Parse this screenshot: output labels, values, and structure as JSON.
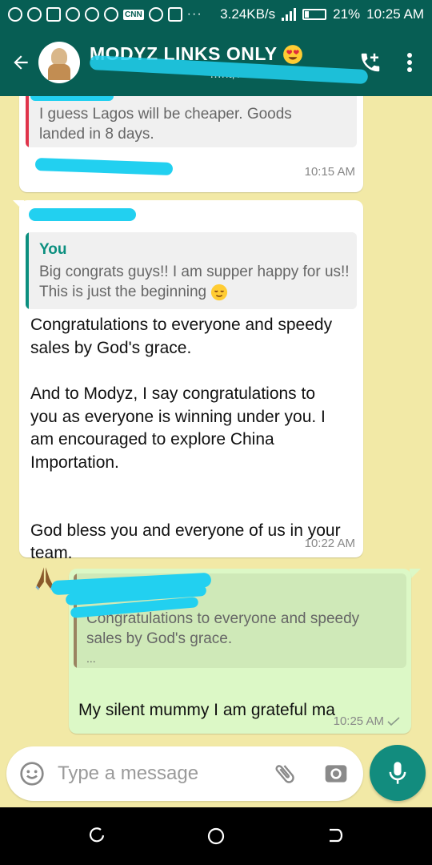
{
  "status_bar": {
    "speed": "3.24KB/s",
    "battery": "21%",
    "time": "10:25 AM",
    "app_badge": "CNN"
  },
  "header": {
    "group_name": "MODYZ LINKS ONLY",
    "subtitle": "…nt, Au…"
  },
  "messages": [
    {
      "direction": "incoming",
      "quote_text": "I guess Lagos will be cheaper. Goods landed in 8 days.",
      "time": "10:15 AM"
    },
    {
      "direction": "incoming",
      "quote_author": "You",
      "quote_text": "Big congrats guys!! I am supper happy for us!! This is just the beginning",
      "body_para1": "Congratulations to everyone and speedy sales by God's grace.",
      "body_para2": "And to Modyz, I say congratulations to you as everyone is winning under you. I am encouraged to explore China Importation.",
      "body_para3": "God bless you and everyone of us in your team.",
      "time": "10:22 AM"
    },
    {
      "direction": "outgoing",
      "quote_text": "Congratulations to everyone and speedy sales by God's grace.",
      "quote_more": "...",
      "body": "My silent mummy I am grateful ma",
      "time": "10:25 AM"
    }
  ],
  "composer": {
    "placeholder": "Type a message"
  },
  "colors": {
    "header": "#075e54",
    "wallpaper": "#f2e9a6",
    "outgoing_bubble": "#dcf8c6",
    "mic_button": "#128c7e",
    "redaction": "#22d0f0"
  }
}
